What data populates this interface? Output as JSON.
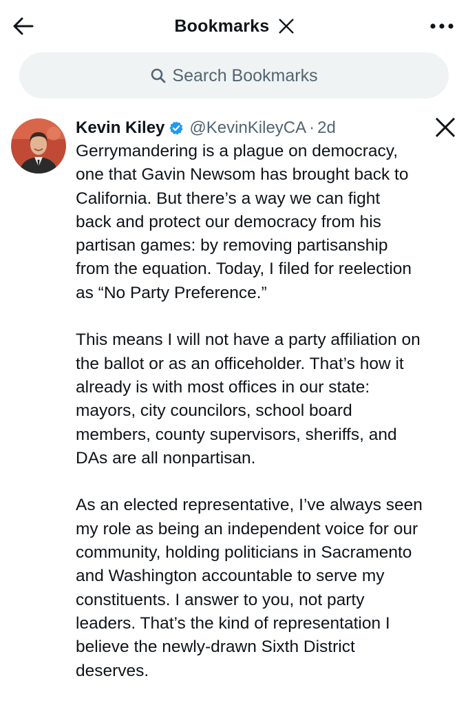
{
  "header": {
    "back_icon": "back-arrow-icon",
    "title": "Bookmarks",
    "logo_icon": "x-logo-icon",
    "more_icon": "more-dots-icon"
  },
  "search": {
    "icon": "search-icon",
    "placeholder": "Search Bookmarks"
  },
  "tweet": {
    "author": {
      "name": "Kevin Kiley",
      "verified_icon": "verified-badge-icon",
      "handle": "@KevinKileyCA",
      "separator": "·",
      "time": "2d"
    },
    "source_icon": "x-logo-icon",
    "paragraphs": [
      "Gerrymandering is a plague on democracy,\none that Gavin Newsom has brought back to\nCalifornia. But there’s a way we can fight\nback and protect our democracy from his\npartisan games: by removing partisanship\nfrom the equation. Today, I filed for reelection\nas “No Party Preference.”",
      "This means I will not have a party affiliation on\nthe ballot or as an officeholder. That’s how it\nalready is with most offices in our state:\nmayors, city councilors, school board\nmembers, county supervisors, sheriffs, and\nDAs are all nonpartisan.",
      "As an elected representative, I’ve always seen\nmy role as being an independent voice for our\ncommunity, holding politicians in Sacramento\nand Washington accountable to serve my\nconstituents. I answer to you, not party\nleaders. That’s the kind of representation I\nbelieve the newly-drawn Sixth District\ndeserves."
    ]
  },
  "colors": {
    "text": "#0f1419",
    "secondary": "#536471",
    "search_bg": "#eff3f4",
    "verified": "#1d9bf0",
    "avatar_bg": "#b8432f"
  }
}
